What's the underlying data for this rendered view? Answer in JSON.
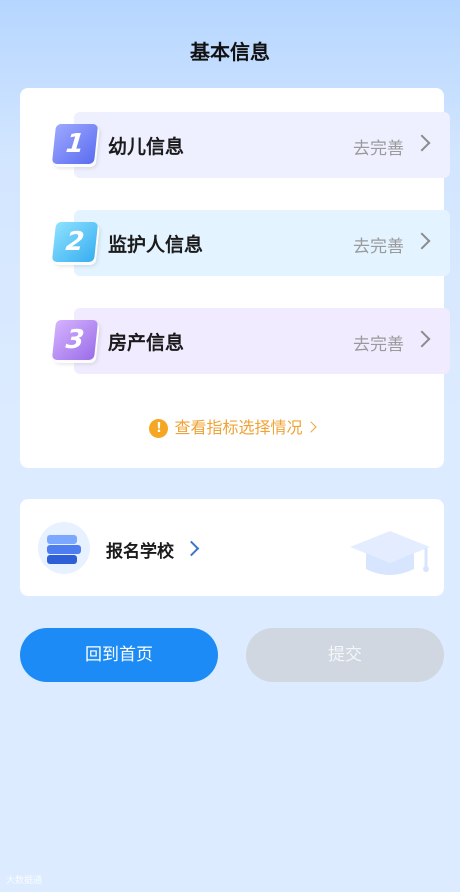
{
  "header": {
    "title": "基本信息"
  },
  "info_items": [
    {
      "number": "1",
      "label": "幼儿信息",
      "action": "去完善"
    },
    {
      "number": "2",
      "label": "监护人信息",
      "action": "去完善"
    },
    {
      "number": "3",
      "label": "房产信息",
      "action": "去完善"
    }
  ],
  "hint": {
    "text": "查看指标选择情况",
    "icon": "warning-icon"
  },
  "school": {
    "label": "报名学校"
  },
  "buttons": {
    "home": "回到首页",
    "submit": "提交"
  },
  "watermark": {
    "text": "大数据通"
  },
  "colors": {
    "primary": "#1c8bf5",
    "disabled": "#d0d7e0",
    "hint": "#f0a236",
    "item1_bg": "#eef0ff",
    "item2_bg": "#e3f3ff",
    "item3_bg": "#f1ebff"
  }
}
